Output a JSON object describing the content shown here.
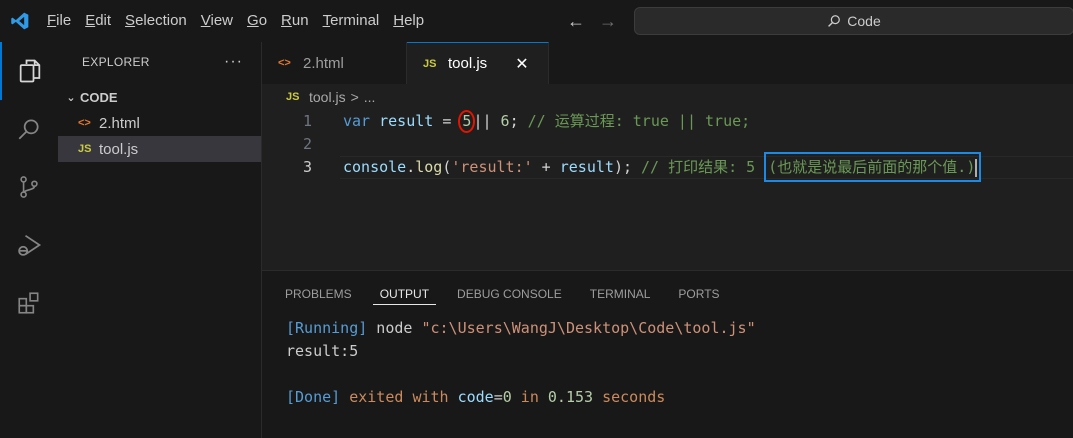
{
  "menu": {
    "file": {
      "u": "F",
      "rest": "ile"
    },
    "edit": {
      "u": "E",
      "rest": "dit"
    },
    "selection": {
      "u": "S",
      "rest": "election"
    },
    "view": {
      "u": "V",
      "rest": "iew"
    },
    "go": {
      "u": "G",
      "rest": "o"
    },
    "run": {
      "u": "R",
      "rest": "un"
    },
    "terminal": {
      "u": "T",
      "rest": "erminal"
    },
    "help": {
      "u": "H",
      "rest": "elp"
    }
  },
  "command_center": {
    "label": "Code"
  },
  "sidebar": {
    "title": "EXPLORER",
    "more": "···",
    "section": "CODE",
    "files": [
      {
        "icon": "<>",
        "name": "2.html"
      },
      {
        "icon": "JS",
        "name": "tool.js"
      }
    ]
  },
  "tabs": [
    {
      "icon": "<>",
      "label": "2.html"
    },
    {
      "icon": "JS",
      "label": "tool.js",
      "close": "✕"
    }
  ],
  "breadcrumb": {
    "icon": "JS",
    "file": "tool.js",
    "sep": ">",
    "rest": "..."
  },
  "editor": {
    "line_numbers": [
      "1",
      "2",
      "3"
    ],
    "line1": {
      "kw": "var",
      "var": "result",
      "eq": " = ",
      "circled": "5",
      "ops": "|| ",
      "num": "6",
      "semi": ";",
      "comment": " // 运算过程: true || true;"
    },
    "line3": {
      "obj": "console",
      "dot": ".",
      "fn": "log",
      "open": "(",
      "str": "'result:'",
      "plus": " + ",
      "var": "result",
      "close": ");",
      "comment": " // 打印结果: 5 ",
      "boxed": "(也就是说最后前面的那个值.)"
    }
  },
  "panel": {
    "tabs": [
      "PROBLEMS",
      "OUTPUT",
      "DEBUG CONSOLE",
      "TERMINAL",
      "PORTS"
    ],
    "running_tag": "[Running]",
    "running_cmd": " node ",
    "running_path": "\"c:\\Users\\WangJ\\Desktop\\Code\\tool.js\"",
    "result": "result:5",
    "done_tag": "[Done]",
    "done_1": " exited ",
    "done_2": "with",
    "done_3": " code",
    "done_4": "=",
    "done_5": "0",
    "done_6": " in ",
    "done_7": "0.153",
    "done_8": " seconds"
  },
  "colors": {
    "accent": "#0078d4",
    "annotation_red": "#e51400",
    "annotation_blue": "#1e88e5"
  }
}
